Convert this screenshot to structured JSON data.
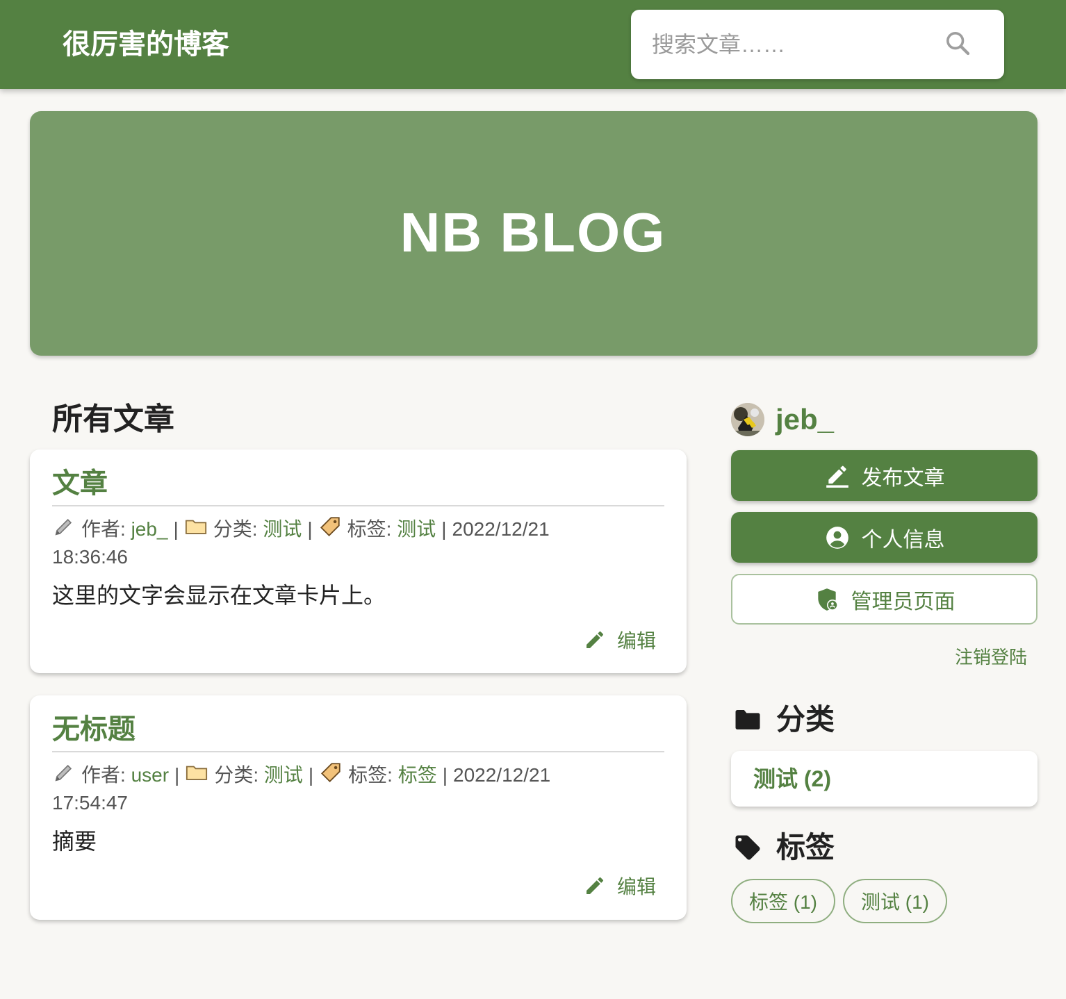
{
  "header": {
    "site_title": "很厉害的博客",
    "search_placeholder": "搜索文章……"
  },
  "banner": {
    "title": "NB BLOG"
  },
  "main": {
    "heading": "所有文章",
    "articles": [
      {
        "title": "文章",
        "author_label": "作者:",
        "author": "jeb_",
        "category_label": "分类:",
        "category": "测试",
        "tag_label": "标签:",
        "tag": "测试",
        "date": "2022/12/21",
        "time": "18:36:46",
        "summary": "这里的文字会显示在文章卡片上。",
        "edit_label": "编辑"
      },
      {
        "title": "无标题",
        "author_label": "作者:",
        "author": "user",
        "category_label": "分类:",
        "category": "测试",
        "tag_label": "标签:",
        "tag": "标签",
        "date": "2022/12/21",
        "time": "17:54:47",
        "summary": "摘要",
        "edit_label": "编辑"
      }
    ]
  },
  "sidebar": {
    "username": "jeb_",
    "publish_label": "发布文章",
    "profile_label": "个人信息",
    "admin_label": "管理员页面",
    "logout_label": "注销登陆",
    "categories_heading": "分类",
    "categories": [
      {
        "label": "测试 (2)"
      }
    ],
    "tags_heading": "标签",
    "tags": [
      {
        "label": "标签 (1)"
      },
      {
        "label": "测试 (1)"
      }
    ]
  },
  "colors": {
    "primary": "#548142",
    "banner": "#789b69",
    "background": "#f8f7f4"
  },
  "icons": [
    "search-icon",
    "pencil-icon",
    "folder-icon",
    "tag-icon",
    "edit-icon",
    "publish-icon",
    "account-icon",
    "admin-shield-icon",
    "folder-solid-icon",
    "tag-solid-icon"
  ]
}
